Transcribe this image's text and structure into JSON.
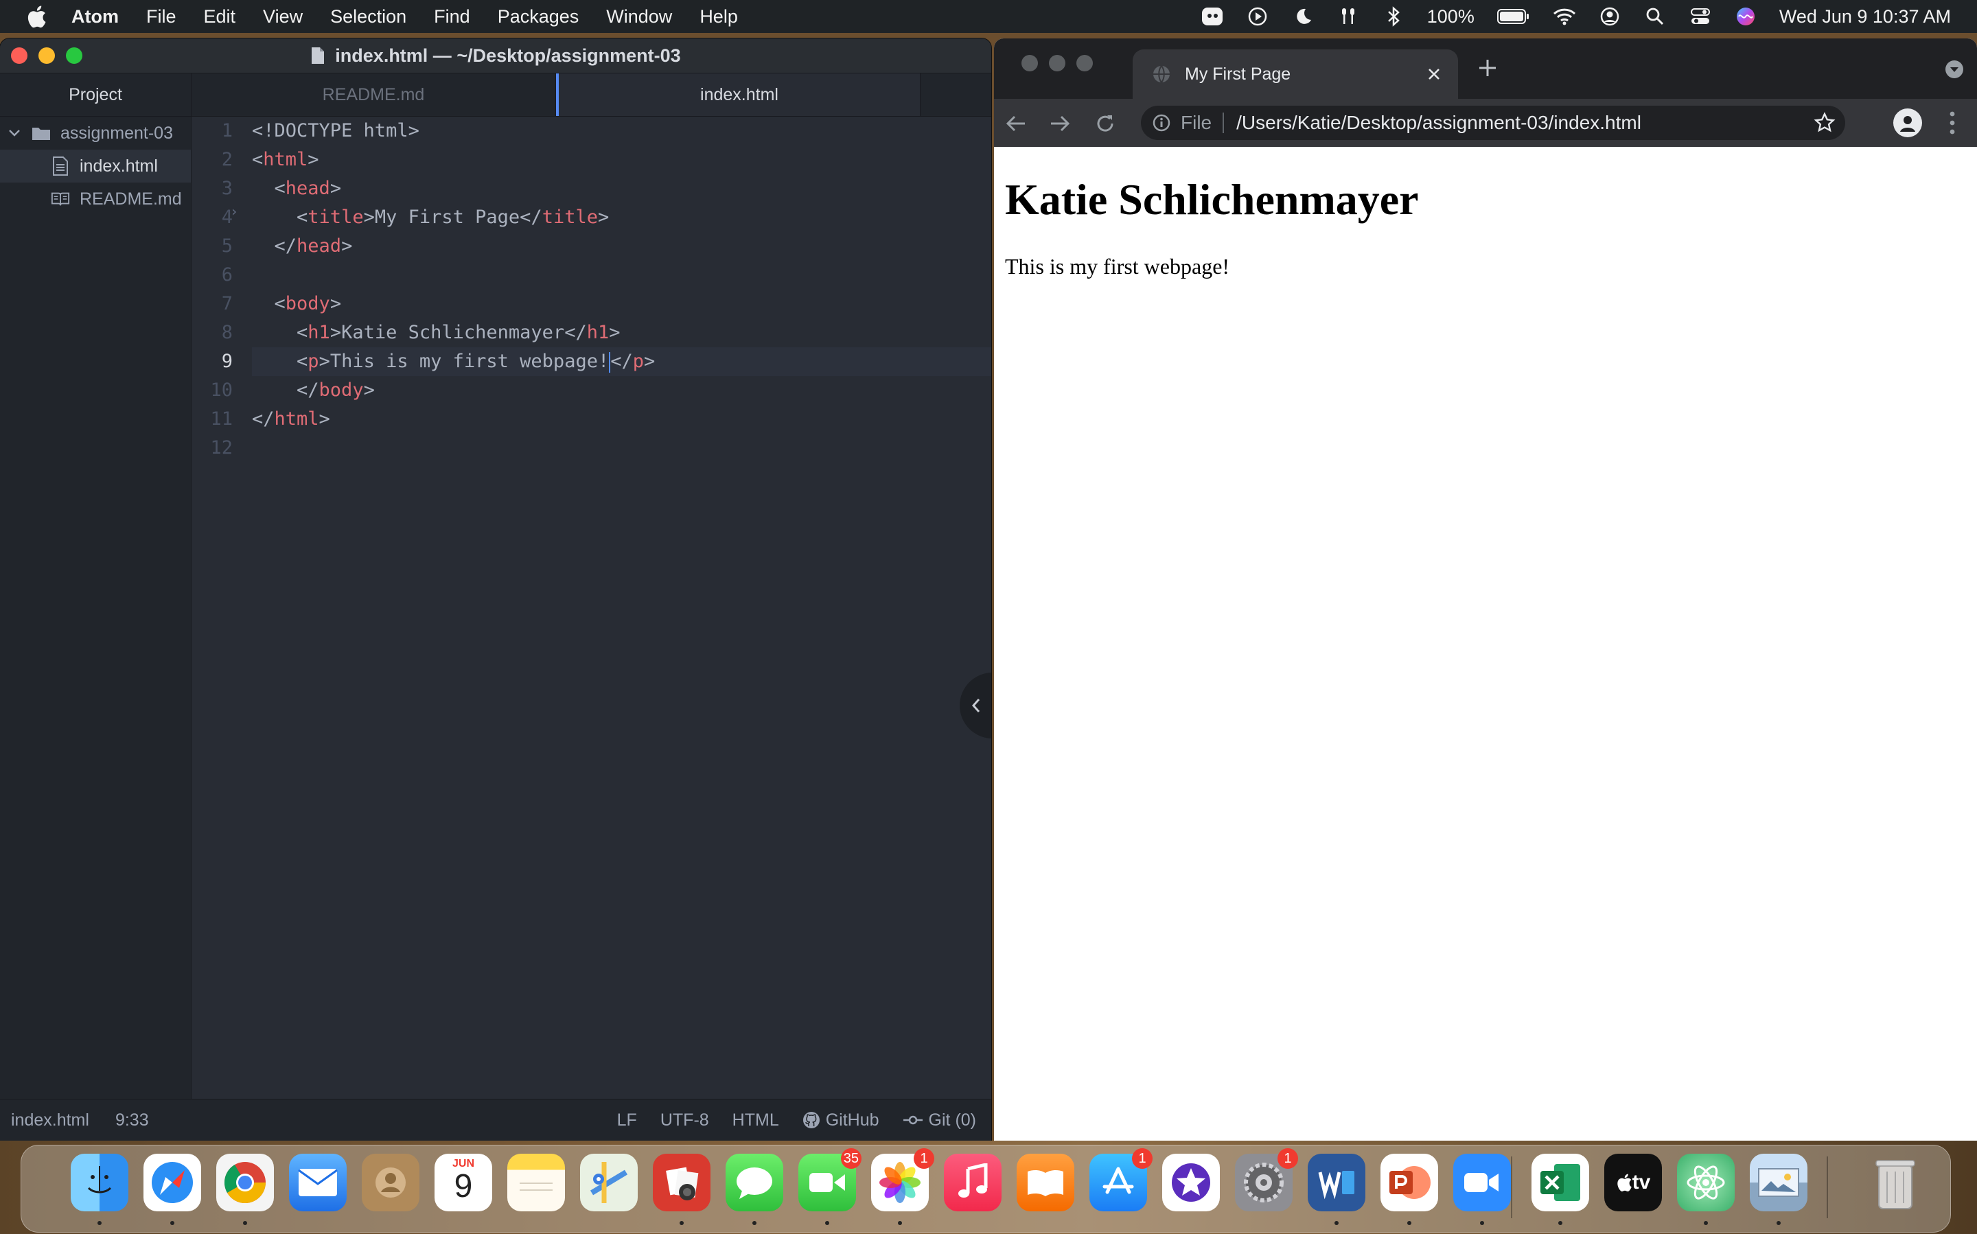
{
  "menubar": {
    "app": "Atom",
    "items": [
      "File",
      "Edit",
      "View",
      "Selection",
      "Find",
      "Packages",
      "Window",
      "Help"
    ],
    "battery": "100%",
    "datetime": "Wed Jun 9  10:37 AM"
  },
  "atom": {
    "window_title": "index.html — ~/Desktop/assignment-03",
    "sidebar": {
      "title": "Project",
      "folder": "assignment-03",
      "files": [
        {
          "name": "index.html",
          "selected": true
        },
        {
          "name": "README.md",
          "selected": false
        }
      ]
    },
    "tabs": [
      {
        "label": "README.md",
        "active": false
      },
      {
        "label": "index.html",
        "active": true
      }
    ],
    "line_numbers": [
      "1",
      "2",
      "3",
      "4",
      "5",
      "6",
      "7",
      "8",
      "9",
      "10",
      "11",
      "12"
    ],
    "current_line": 9,
    "code": {
      "l1": "<!DOCTYPE html>",
      "l2_tag": "html",
      "l3_tag": "head",
      "l4_tag": "title",
      "l4_text": "My First Page",
      "l5_tag": "head",
      "l7_tag": "body",
      "l8_tag": "h1",
      "l8_text": "Katie Schlichenmayer",
      "l9_tag": "p",
      "l9_text": "This is my first webpage!",
      "l10_tag": "body",
      "l11_tag": "html"
    },
    "status": {
      "file": "index.html",
      "cursor": "9:33",
      "line_ending": "LF",
      "encoding": "UTF-8",
      "grammar": "HTML",
      "github": "GitHub",
      "git": "Git (0)"
    }
  },
  "chrome": {
    "tab_title": "My First Page",
    "scheme": "File",
    "url": "/Users/Katie/Desktop/assignment-03/index.html",
    "page": {
      "heading": "Katie Schlichenmayer",
      "paragraph": "This is my first webpage!"
    }
  },
  "dock": {
    "calendar_month": "JUN",
    "calendar_day": "9",
    "badges": {
      "facetime": "35",
      "photos": "1",
      "appstore": "1",
      "settings": "1"
    },
    "tv_label": "tv"
  }
}
